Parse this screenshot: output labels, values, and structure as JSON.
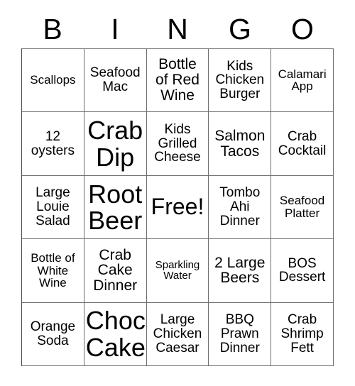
{
  "card": {
    "header_letters": [
      "B",
      "I",
      "N",
      "G",
      "O"
    ],
    "rows": [
      [
        {
          "text": "Scallops",
          "size": "sm"
        },
        {
          "text": "Seafood\nMac",
          "size": "md"
        },
        {
          "text": "Bottle\nof Red\nWine",
          "size": "lg"
        },
        {
          "text": "Kids\nChicken\nBurger",
          "size": "md"
        },
        {
          "text": "Calamari\nApp",
          "size": "sm"
        }
      ],
      [
        {
          "text": "12\noysters",
          "size": "md"
        },
        {
          "text": "Crab\nDip",
          "size": "xxl"
        },
        {
          "text": "Kids\nGrilled\nCheese",
          "size": "md"
        },
        {
          "text": "Salmon\nTacos",
          "size": "lg"
        },
        {
          "text": "Crab\nCocktail",
          "size": "md"
        }
      ],
      [
        {
          "text": "Large\nLouie\nSalad",
          "size": "md"
        },
        {
          "text": "Root\nBeer",
          "size": "xxl"
        },
        {
          "text": "Free!",
          "size": "free"
        },
        {
          "text": "Tombo\nAhi\nDinner",
          "size": "md"
        },
        {
          "text": "Seafood\nPlatter",
          "size": "sm"
        }
      ],
      [
        {
          "text": "Bottle of\nWhite\nWine",
          "size": "sm"
        },
        {
          "text": "Crab\nCake\nDinner",
          "size": "lg"
        },
        {
          "text": "Sparkling\nWater",
          "size": "xs"
        },
        {
          "text": "2 Large\nBeers",
          "size": "lg"
        },
        {
          "text": "BOS\nDessert",
          "size": "md"
        }
      ],
      [
        {
          "text": "Orange\nSoda",
          "size": "md"
        },
        {
          "text": "Choc\nCake",
          "size": "xxl"
        },
        {
          "text": "Large\nChicken\nCaesar",
          "size": "md"
        },
        {
          "text": "BBQ\nPrawn\nDinner",
          "size": "md"
        },
        {
          "text": "Crab\nShrimp\nFett",
          "size": "md"
        }
      ]
    ]
  }
}
